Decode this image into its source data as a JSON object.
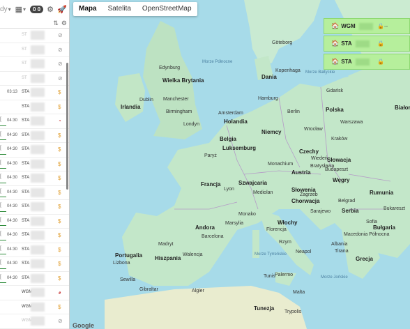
{
  "toolbar": {
    "date_fragment": "dy",
    "chevron": "▾",
    "calendar_icon": "▦",
    "count_badge": "0 0"
  },
  "vehicle_rows": [
    {
      "time": "",
      "label": "ST",
      "status": "⊘",
      "dim": true,
      "bar": false,
      "bracket": ""
    },
    {
      "time": "",
      "label": "ST",
      "status": "⊘",
      "dim": true,
      "bar": false,
      "bracket": ""
    },
    {
      "time": "",
      "label": "ST",
      "status": "⊘",
      "dim": true,
      "bar": false,
      "bracket": ""
    },
    {
      "time": "",
      "label": "ST",
      "status": "⊘",
      "dim": true,
      "bar": false,
      "bracket": ""
    },
    {
      "time": "03:13",
      "label": "STA",
      "status": "$",
      "dim": false,
      "bar": false,
      "bracket": ""
    },
    {
      "time": "",
      "label": "STA",
      "status": "$",
      "dim": false,
      "bar": false,
      "bracket": ""
    },
    {
      "time": "04:30",
      "label": "STA",
      "status": "◔",
      "dim": false,
      "bar": true,
      "bracket": "["
    },
    {
      "time": "04:30",
      "label": "STA",
      "status": "$",
      "dim": false,
      "bar": true,
      "bracket": "["
    },
    {
      "time": "04:30",
      "label": "STA",
      "status": "$",
      "dim": false,
      "bar": true,
      "bracket": "["
    },
    {
      "time": "04:30",
      "label": "STA",
      "status": "$",
      "dim": false,
      "bar": true,
      "bracket": "["
    },
    {
      "time": "04:30",
      "label": "STA",
      "status": "$",
      "dim": false,
      "bar": true,
      "bracket": "["
    },
    {
      "time": "04:30",
      "label": "STA",
      "status": "$",
      "dim": false,
      "bar": true,
      "bracket": "["
    },
    {
      "time": "04:30",
      "label": "STA",
      "status": "$",
      "dim": false,
      "bar": true,
      "bracket": "["
    },
    {
      "time": "04:30",
      "label": "STA",
      "status": "$",
      "dim": false,
      "bar": true,
      "bracket": "["
    },
    {
      "time": "04:30",
      "label": "STA",
      "status": "$",
      "dim": false,
      "bar": true,
      "bracket": "["
    },
    {
      "time": "04:30",
      "label": "STA",
      "status": "$",
      "dim": false,
      "bar": true,
      "bracket": "["
    },
    {
      "time": "04:30",
      "label": "STA",
      "status": "$",
      "dim": false,
      "bar": true,
      "bracket": "["
    },
    {
      "time": "04:30",
      "label": "STA",
      "status": "$",
      "dim": false,
      "bar": true,
      "bracket": "["
    },
    {
      "time": "",
      "label": "WGM",
      "status": "◕",
      "dim": false,
      "bar": false,
      "bracket": ""
    },
    {
      "time": "",
      "label": "WGM",
      "status": "$",
      "dim": false,
      "bar": false,
      "bracket": ""
    },
    {
      "time": "",
      "label": "WGM",
      "status": "⊘",
      "dim": true,
      "bar": false,
      "bracket": ""
    },
    {
      "time": "",
      "label": "WGM",
      "status": "$",
      "dim": false,
      "bar": false,
      "bracket": ""
    }
  ],
  "map_tabs": [
    "Mapa",
    "Satelita",
    "OpenStreetMap"
  ],
  "map_cards": [
    {
      "label": "WGM",
      "suffix": "--"
    },
    {
      "label": "STA",
      "suffix": ""
    },
    {
      "label": "STA",
      "suffix": ""
    }
  ],
  "map_labels": {
    "countries": [
      "Irlandia",
      "Wielka Brytania",
      "Holandia",
      "Belgia",
      "Luksemburg",
      "Francja",
      "Niemcy",
      "Polska",
      "Czechy",
      "Słowacja",
      "Austria",
      "Węgry",
      "Rumunia",
      "Słowenia",
      "Chorwacja",
      "Serbia",
      "Bułgaria",
      "Włochy",
      "Hiszpania",
      "Portugalia",
      "Dania",
      "Grecja",
      "Albania",
      "Macedonia Północna",
      "Tunezja",
      "Monako",
      "Szwajcaria",
      "Andora",
      "Białoruś"
    ],
    "cities": [
      "Edynburg",
      "Dublin",
      "Manchester",
      "Birmingham",
      "Londyn",
      "Amsterdam",
      "Hamburg",
      "Berlin",
      "Paryż",
      "Monachium",
      "Wiedeń",
      "Budapeszt",
      "Lyon",
      "Marsylia",
      "Barcelona",
      "Madryt",
      "Lizbona",
      "Walencja",
      "Rzym",
      "Neapol",
      "Florencja",
      "Mediolan",
      "Sewilla",
      "Gibraltar",
      "Algier",
      "Tunis",
      "Malta",
      "Palermo",
      "Kopenhaga",
      "Göteborg",
      "Warszawa",
      "Gdańsk",
      "Bukareszt",
      "Belgrad",
      "Sofia",
      "Zagrzeb",
      "Sarajewo",
      "Kraków",
      "Tirana",
      "Wrocław",
      "Trypolis",
      "Bratysława"
    ],
    "seas": [
      "Morze Północne",
      "Morze Bałtyckie",
      "Morze Tyrreńskie",
      "Morze Jońskie"
    ]
  },
  "google_mark": "Google"
}
